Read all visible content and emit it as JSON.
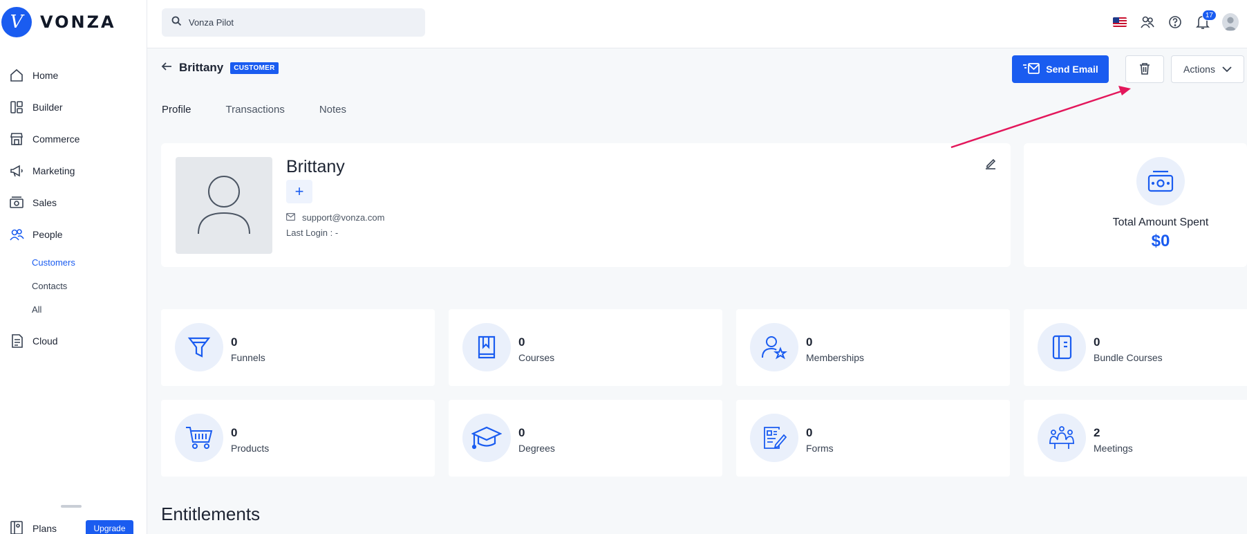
{
  "brand": {
    "name": "VONZA",
    "mark": "V"
  },
  "sidebar": {
    "items": [
      {
        "label": "Home",
        "icon": "home-icon"
      },
      {
        "label": "Builder",
        "icon": "builder-icon"
      },
      {
        "label": "Commerce",
        "icon": "store-icon"
      },
      {
        "label": "Marketing",
        "icon": "megaphone-icon"
      },
      {
        "label": "Sales",
        "icon": "cash-icon"
      },
      {
        "label": "People",
        "icon": "people-icon"
      }
    ],
    "people_sub": [
      "Customers",
      "Contacts",
      "All"
    ],
    "cloud": {
      "label": "Cloud",
      "icon": "cloud-doc-icon"
    },
    "plans": {
      "label": "Plans",
      "icon": "plans-icon"
    },
    "upgrade_label": "Upgrade"
  },
  "topbar": {
    "search_value": "Vonza Pilot",
    "notification_count": "17"
  },
  "header": {
    "name": "Brittany",
    "badge": "CUSTOMER",
    "send_email_label": "Send Email",
    "actions_label": "Actions"
  },
  "tabs": [
    "Profile",
    "Transactions",
    "Notes"
  ],
  "profile": {
    "name": "Brittany",
    "add_symbol": "+",
    "email": "support@vonza.com",
    "last_login": "Last Login : -"
  },
  "spent": {
    "label": "Total Amount Spent",
    "value": "$0"
  },
  "stats": [
    {
      "value": "0",
      "label": "Funnels",
      "icon": "funnel-icon"
    },
    {
      "value": "0",
      "label": "Courses",
      "icon": "bookmark-book-icon"
    },
    {
      "value": "0",
      "label": "Memberships",
      "icon": "member-star-icon"
    },
    {
      "value": "0",
      "label": "Bundle Courses",
      "icon": "notebook-icon"
    },
    {
      "value": "0",
      "label": "Products",
      "icon": "cart-icon"
    },
    {
      "value": "0",
      "label": "Degrees",
      "icon": "graduation-cap-icon"
    },
    {
      "value": "0",
      "label": "Forms",
      "icon": "form-pen-icon"
    },
    {
      "value": "2",
      "label": "Meetings",
      "icon": "meeting-icon"
    }
  ],
  "section_title": "Entitlements",
  "colors": {
    "accent": "#1a5cf0",
    "annotation": "#e3175b"
  }
}
